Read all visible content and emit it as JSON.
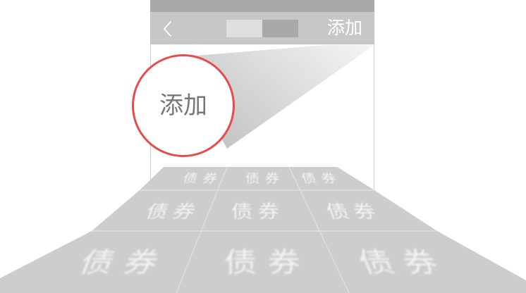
{
  "nav_bar": {
    "back_icon": "chevron-left-icon",
    "add_label": "添加"
  },
  "magnifier": {
    "label": "添加"
  },
  "floor": {
    "rows": [
      {
        "tiles": [
          "债券",
          "债券",
          "债券"
        ]
      },
      {
        "tiles": [
          "债券",
          "债券",
          "债券"
        ]
      },
      {
        "tiles": [
          "债券",
          "债券",
          "债券"
        ]
      }
    ]
  },
  "colors": {
    "status_bar": "#a9a9a9",
    "nav_bar": "#c7c7c7",
    "segment_left": "#dedede",
    "segment_right": "#a9a9a9",
    "magnifier_border": "#e84b4b",
    "magnifier_text": "#777777",
    "floor": "#cdcdcd",
    "tile_text": "#f3f3f3"
  }
}
